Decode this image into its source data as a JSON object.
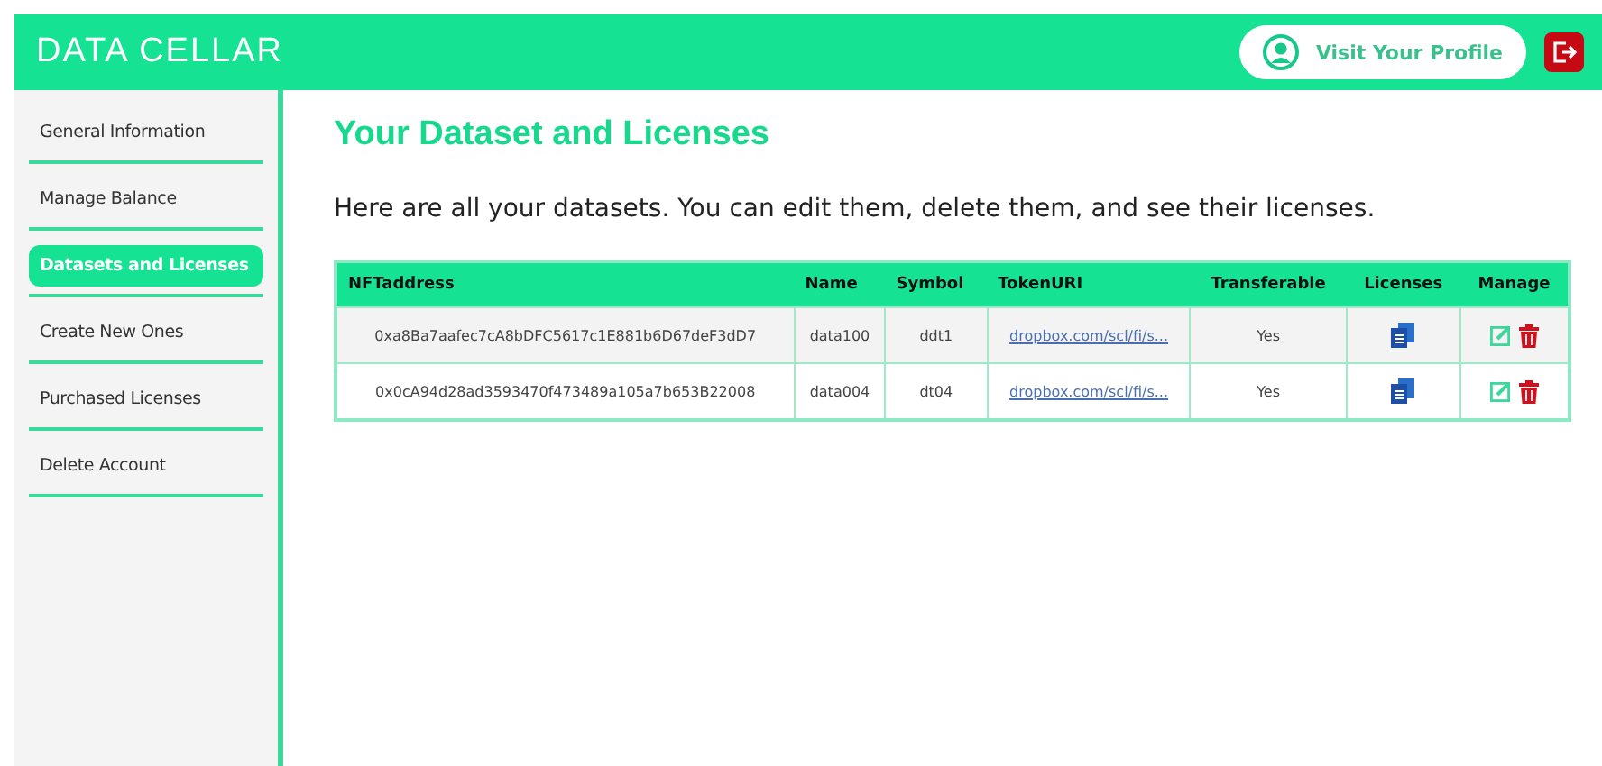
{
  "header": {
    "logo": "DATA CELLAR",
    "profile_button": "Visit Your Profile"
  },
  "sidebar": {
    "items": [
      {
        "label": "General Information",
        "selected": false
      },
      {
        "label": "Manage Balance",
        "selected": false
      },
      {
        "label": "Datasets and Licenses",
        "selected": true
      },
      {
        "label": "Create New Ones",
        "selected": false
      },
      {
        "label": "Purchased Licenses",
        "selected": false
      },
      {
        "label": "Delete Account",
        "selected": false
      }
    ]
  },
  "main": {
    "title": "Your Dataset and Licenses",
    "description": "Here are all your datasets. You can edit them, delete them, and see their licenses."
  },
  "table": {
    "columns": [
      "NFTaddress",
      "Name",
      "Symbol",
      "TokenURI",
      "Transferable",
      "Licenses",
      "Manage"
    ],
    "rows": [
      {
        "address": "0xa8Ba7aafec7cA8bDFC5617c1E881b6D67deF3dD7",
        "name": "data100",
        "symbol": "ddt1",
        "token_uri": "dropbox.com/scl/fi/s...",
        "transferable": "Yes"
      },
      {
        "address": "0x0cA94d28ad3593470f473489a105a7b653B22008",
        "name": "data004",
        "symbol": "dt04",
        "token_uri": "dropbox.com/scl/fi/s...",
        "transferable": "Yes"
      }
    ]
  }
}
